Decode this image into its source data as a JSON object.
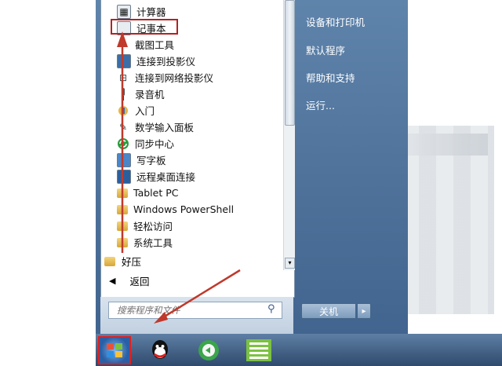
{
  "programs": [
    {
      "label": "计算器",
      "icon": "calculator-icon"
    },
    {
      "label": "记事本",
      "icon": "notepad-icon"
    },
    {
      "label": "截图工具",
      "icon": "scissors-icon"
    },
    {
      "label": "连接到投影仪",
      "icon": "projector-icon"
    },
    {
      "label": "连接到网络投影仪",
      "icon": "network-projector-icon"
    },
    {
      "label": "录音机",
      "icon": "microphone-icon"
    },
    {
      "label": "入门",
      "icon": "getting-started-icon"
    },
    {
      "label": "数学输入面板",
      "icon": "math-input-icon"
    },
    {
      "label": "同步中心",
      "icon": "sync-icon"
    },
    {
      "label": "写字板",
      "icon": "wordpad-icon"
    },
    {
      "label": "远程桌面连接",
      "icon": "remote-desktop-icon"
    },
    {
      "label": "Tablet PC",
      "icon": "folder-icon"
    },
    {
      "label": "Windows PowerShell",
      "icon": "folder-icon"
    },
    {
      "label": "轻松访问",
      "icon": "folder-icon"
    },
    {
      "label": "系统工具",
      "icon": "folder-icon"
    }
  ],
  "top_folder": {
    "label": "好压",
    "icon": "folder-icon"
  },
  "back": {
    "label": "返回",
    "icon": "left-triangle-icon"
  },
  "search": {
    "placeholder": "搜索程序和文件",
    "icon": "search-icon"
  },
  "right_pane": {
    "devices": "设备和打印机",
    "default_programs": "默认程序",
    "help": "帮助和支持",
    "run": "运行..."
  },
  "shutdown": {
    "label": "关机",
    "arrow": "▸"
  },
  "colors": {
    "highlight": "#b22222",
    "annotation_arrow": "#c0392b",
    "menu_blue": "#4d7099"
  }
}
